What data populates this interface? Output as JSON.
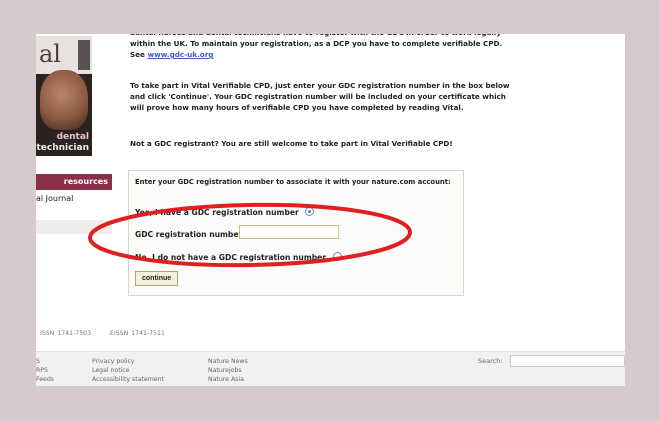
{
  "cover": {
    "title": "al",
    "line1": "dental",
    "line2": "technician"
  },
  "nav": {
    "resources_label": "resources",
    "journal_label": "al Journal"
  },
  "intro": {
    "p1": "dental nurses and dental technicians have to register with the GDC in order to work legally within the UK. To maintain your registration, as a DCP you have to complete verifiable CPD. See",
    "p1_link": "www.gdc-uk.org",
    "p2": "To take part in Vital Verifiable CPD, just enter your GDC registration number in the box below and click 'Continue'. Your GDC registration number will be included on your certificate which will prove how many hours of verifiable CPD you have completed by reading Vital.",
    "p3": "Not a GDC registrant? You are still welcome to take part in Vital Verifiable CPD!"
  },
  "form": {
    "heading": "Enter your GDC registration number to associate it with your nature.com account:",
    "yes_label": "Yes, I have a GDC registration number",
    "yes_selected": true,
    "number_label": "GDC registration number:",
    "number_value": "",
    "no_label": "No, I do not have a GDC registration number",
    "continue_label": "continue"
  },
  "issn": {
    "print": "ISSN 1741-7503",
    "online": "EISSN 1741-7511"
  },
  "footer": {
    "col1": [
      "S",
      "RPS",
      "Feeds"
    ],
    "col2": [
      "Privacy policy",
      "Legal notice",
      "Accessibility statement"
    ],
    "col3": [
      "Nature News",
      "Naturejobs",
      "Nature Asia"
    ],
    "search_label": "Search:",
    "search_value": ""
  },
  "colors": {
    "highlight": "#e02020",
    "resources_bar": "#8b2f4a",
    "link": "#3b5dbb"
  }
}
